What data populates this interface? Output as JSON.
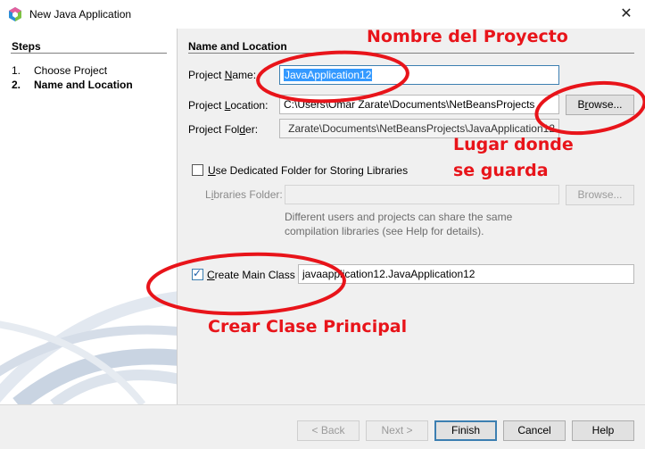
{
  "window": {
    "title": "New Java Application",
    "close_symbol": "✕"
  },
  "steps": {
    "header": "Steps",
    "items": [
      {
        "num": "1.",
        "label": "Choose Project"
      },
      {
        "num": "2.",
        "label": "Name and Location"
      }
    ]
  },
  "form": {
    "section_title": "Name and Location",
    "project_name": {
      "label_pre": "Project ",
      "label_mn": "N",
      "label_post": "ame:",
      "value": "JavaApplication12"
    },
    "project_location": {
      "label_pre": "Project ",
      "label_mn": "L",
      "label_post": "ocation:",
      "value": "C:\\Users\\Omar Zarate\\Documents\\NetBeansProjects"
    },
    "browse_label_mn": "r",
    "browse_label_pre": "B",
    "browse_label_post": "owse...",
    "project_folder": {
      "label_pre": "Project Fol",
      "label_mn": "d",
      "label_post": "er:",
      "value": "Zarate\\Documents\\NetBeansProjects\\JavaApplication12"
    },
    "dedicated_folder": {
      "label_mn": "U",
      "label_post": "se Dedicated Folder for Storing Libraries",
      "checked": false
    },
    "libraries_folder": {
      "label_pre": "L",
      "label_mn": "i",
      "label_post": "braries Folder:",
      "value": ""
    },
    "libraries_browse": "Browse...",
    "hint_line1": "Different users and projects can share the same",
    "hint_line2": "compilation libraries (see Help for details).",
    "create_main_class": {
      "label_pre": "",
      "label_mn": "C",
      "label_post": "reate Main Class",
      "checked": true,
      "value": "javaapplication12.JavaApplication12"
    }
  },
  "buttons": {
    "back": "< Back",
    "next": "Next >",
    "finish": "Finish",
    "cancel": "Cancel",
    "help": "Help"
  },
  "annotations": {
    "project_name": "Nombre del Proyecto",
    "location_line1": "Lugar donde",
    "location_line2": "se guarda",
    "main_class": "Crear Clase Principal",
    "color": "#e8141a"
  }
}
